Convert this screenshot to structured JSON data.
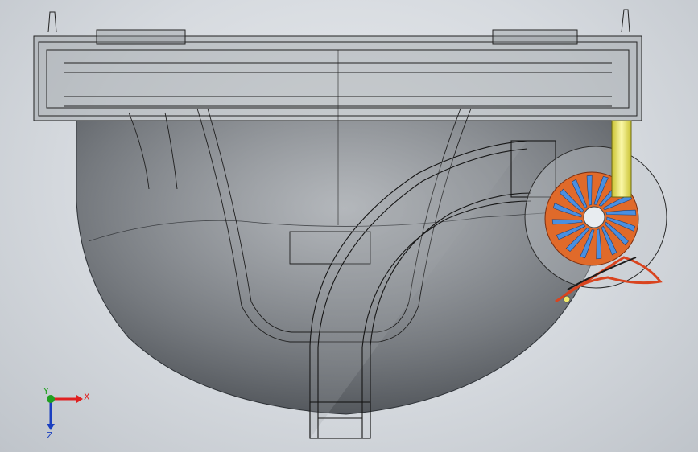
{
  "viewport": {
    "background": "#d6dadf"
  },
  "model": {
    "components": [
      {
        "name": "housing-shell",
        "color": "#55595e"
      },
      {
        "name": "top-rim-frame",
        "color": "#2a2a2a"
      },
      {
        "name": "curved-duct",
        "color": "#1e1e1e"
      },
      {
        "name": "fan-impeller",
        "color": "#4a8fe0"
      },
      {
        "name": "fan-housing-ring",
        "color": "#e06a2a"
      },
      {
        "name": "drive-shaft",
        "color": "#f4f080"
      },
      {
        "name": "wire-harness",
        "color": "#d9441f"
      }
    ]
  },
  "triad": {
    "x_label": "X",
    "y_label": "Y",
    "z_label": "Z",
    "x_color": "#e02020",
    "y_color": "#20a020",
    "z_color": "#1a3fc0"
  }
}
